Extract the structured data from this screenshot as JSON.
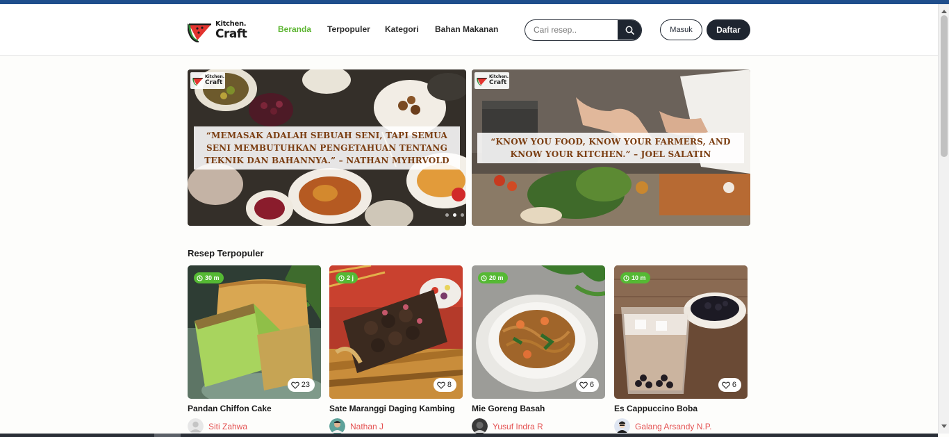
{
  "header": {
    "logo": {
      "line1": "Kitchen.",
      "line2": "Craft"
    },
    "nav": [
      {
        "label": "Beranda",
        "active": true
      },
      {
        "label": "Terpopuler",
        "active": false
      },
      {
        "label": "Kategori",
        "active": false
      },
      {
        "label": "Bahan Makanan",
        "active": false
      }
    ],
    "search": {
      "placeholder": "Cari resep..",
      "icon": "search-icon"
    },
    "login_label": "Masuk",
    "register_label": "Daftar"
  },
  "banners": [
    {
      "badge_line1": "Kitchen.",
      "badge_line2": "Craft",
      "quote": "“MEMASAK ADALAH SEBUAH SENI, TAPI SEMUA SENI MEMBUTUHKAN PENGETAHUAN TENTANG TEKNIK DAN BAHANNYA.” – NATHAN MYHRVOLD"
    },
    {
      "badge_line1": "Kitchen.",
      "badge_line2": "Craft",
      "quote": "“KNOW YOU FOOD, KNOW YOUR FARMERS, AND KNOW YOUR KITCHEN.” – JOEL SALATIN"
    }
  ],
  "popular": {
    "title": "Resep Terpopuler",
    "recipes": [
      {
        "time": "30 m",
        "likes": "23",
        "title": "Pandan Chiffon Cake",
        "author": "Siti Zahwa"
      },
      {
        "time": "2 j",
        "likes": "8",
        "title": "Sate Maranggi Daging Kambing",
        "author": "Nathan J"
      },
      {
        "time": "20 m",
        "likes": "6",
        "title": "Mie Goreng Basah",
        "author": "Yusuf Indra R"
      },
      {
        "time": "10 m",
        "likes": "6",
        "title": "Es Cappuccino Boba",
        "author": "Galang Arsandy N.P."
      }
    ]
  },
  "colors": {
    "accent_green": "#5cb531",
    "dark": "#1e2530",
    "author_red": "#e45252",
    "quote_brown": "#7b3e12",
    "top_stripe": "#1f4e8c"
  }
}
